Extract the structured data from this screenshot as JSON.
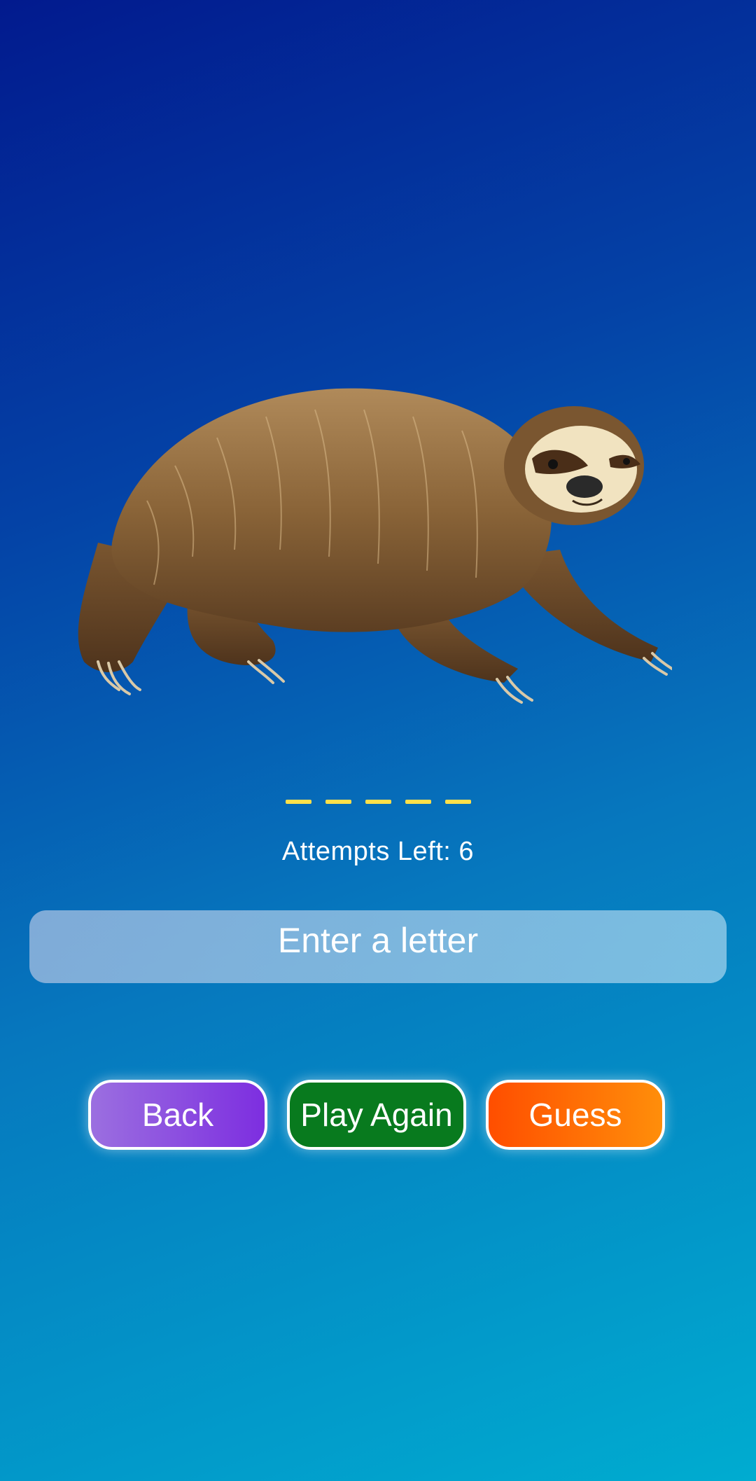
{
  "game": {
    "animal_name": "sloth",
    "word_length": 5,
    "blank_char": "_"
  },
  "status": {
    "attempts_label": "Attempts Left: 6"
  },
  "input": {
    "placeholder": "Enter a letter",
    "value": ""
  },
  "buttons": {
    "back_label": "Back",
    "play_again_label": "Play Again",
    "guess_label": "Guess"
  },
  "colors": {
    "background_top": "#021a8e",
    "background_bottom": "#00acd0",
    "blank_color": "#ffe04a",
    "back_button": "#8a4ee0",
    "play_again_button": "#087a1e",
    "guess_button": "#ff6a00"
  }
}
